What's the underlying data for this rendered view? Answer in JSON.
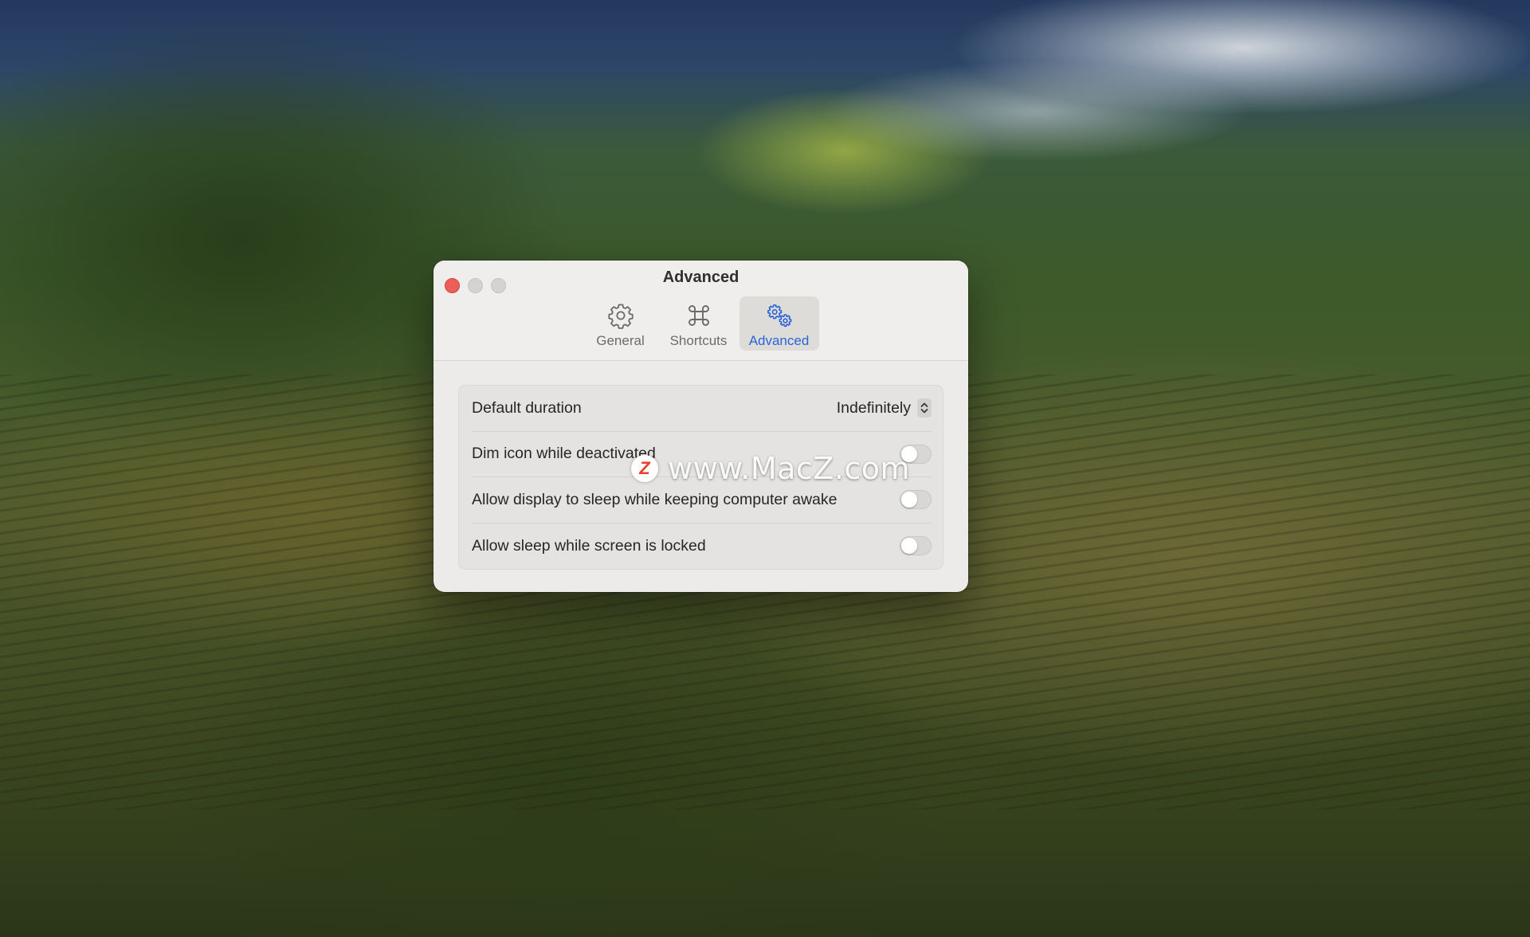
{
  "window": {
    "title": "Advanced"
  },
  "toolbar": {
    "tabs": [
      {
        "label": "General",
        "icon": "gear-icon",
        "selected": false
      },
      {
        "label": "Shortcuts",
        "icon": "command-key-icon",
        "selected": false
      },
      {
        "label": "Advanced",
        "icon": "gears-icon",
        "selected": true
      }
    ],
    "accent_color": "#2a64d6"
  },
  "settings": {
    "default_duration": {
      "label": "Default duration",
      "value": "Indefinitely"
    },
    "dim_icon": {
      "label": "Dim icon while deactivated",
      "enabled": false
    },
    "allow_display_sleep": {
      "label": "Allow display to sleep while keeping computer awake",
      "enabled": false
    },
    "allow_sleep_locked": {
      "label": "Allow sleep while screen is locked",
      "enabled": false
    }
  },
  "watermark": {
    "badge": "Z",
    "text": "www.MacZ.com"
  }
}
